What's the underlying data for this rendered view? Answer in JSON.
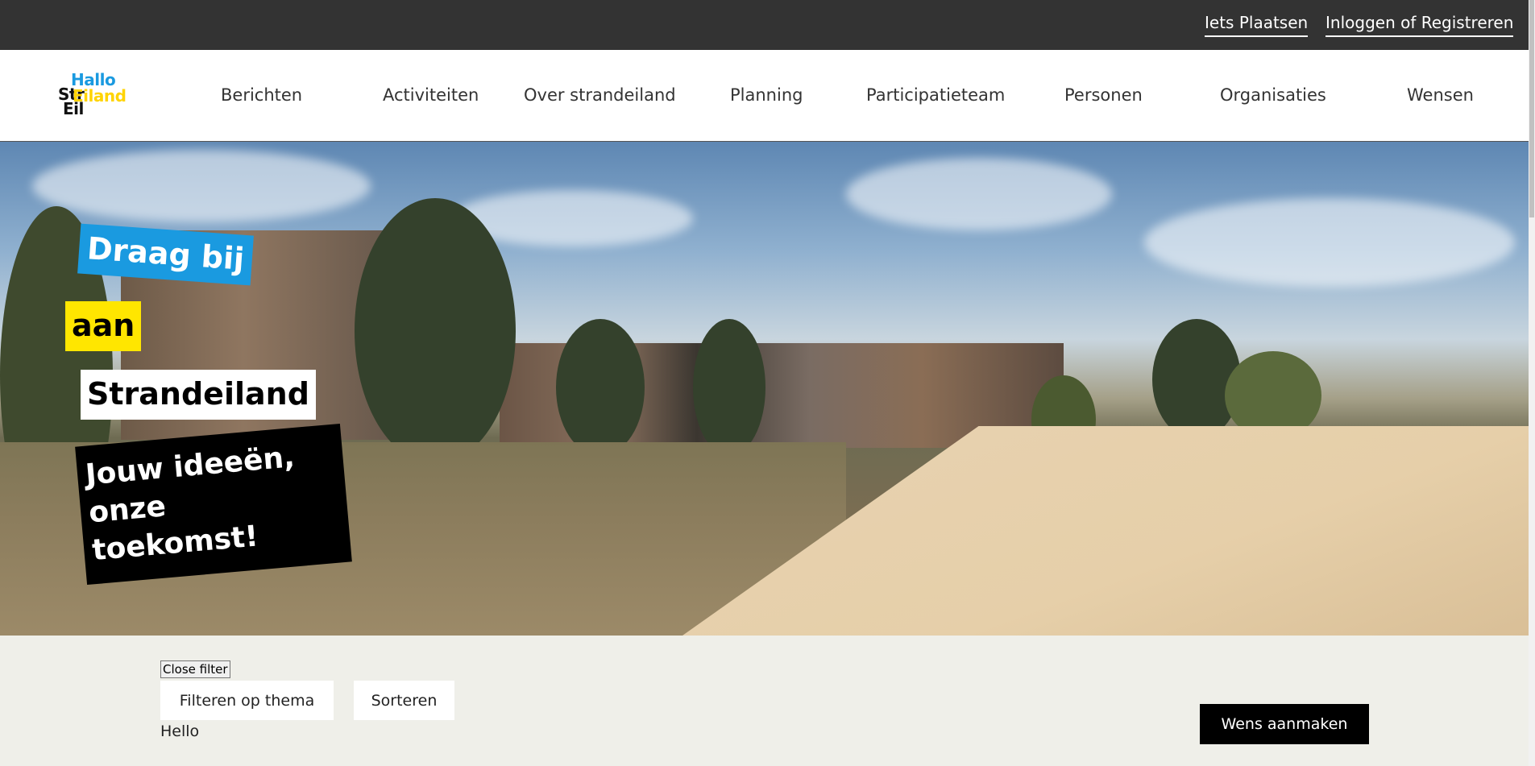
{
  "topbar": {
    "post_label": "Iets Plaatsen",
    "login_label": "Inloggen of Registreren"
  },
  "logo": {
    "hallo": "Hallo",
    "str": "Str",
    "eiland": "Eiland",
    "ei": "Eil"
  },
  "nav": {
    "items": [
      {
        "label": "Berichten"
      },
      {
        "label": "Activiteiten"
      },
      {
        "label": "Over strandeiland"
      },
      {
        "label": "Planning"
      },
      {
        "label": "Participatieteam"
      },
      {
        "label": "Personen"
      },
      {
        "label": "Organisaties"
      },
      {
        "label": "Wensen"
      }
    ]
  },
  "hero": {
    "line1": "Draag bij",
    "line2": "aan",
    "line3": "Strandeiland",
    "tagline": "Jouw ideeën, onze toekomst!"
  },
  "filters": {
    "close_label": "Close filter",
    "theme_label": "Filteren op thema",
    "sort_label": "Sorteren",
    "hello": "Hello",
    "create_label": "Wens aanmaken"
  },
  "colors": {
    "topbar": "#333333",
    "brand_blue": "#1a9ae0",
    "brand_yellow": "#ffe600",
    "filter_bg": "#efefe9"
  }
}
